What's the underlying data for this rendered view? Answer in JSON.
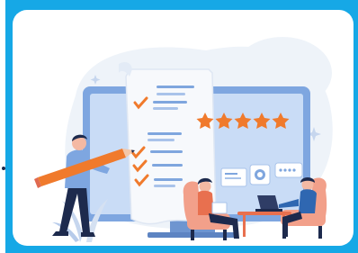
{
  "scene": {
    "type": "illustration",
    "subject": "rating-and-review-checklist",
    "rating": {
      "stars_filled": 5,
      "stars_total": 5
    },
    "checklist_items_checked": 4
  },
  "colors": {
    "frame": "#16a8e6",
    "card_background": "#ffffff",
    "blob": "#eef3f9",
    "monitor": "#7ea6e0",
    "monitor_screen": "#c9dcf6",
    "paper": "#f7f9fc",
    "lines": "#7fa6de",
    "check": "#f07a2c",
    "star": "#f07a2c",
    "chair": "#f2a08a",
    "table": "#e8704f",
    "navy": "#1d2a4d"
  },
  "icons": [
    "document-icon",
    "check-icon",
    "star-icon",
    "pencil-icon",
    "card-icon",
    "coin-icon",
    "password-field-icon",
    "laptop-icon",
    "plant-icon"
  ]
}
